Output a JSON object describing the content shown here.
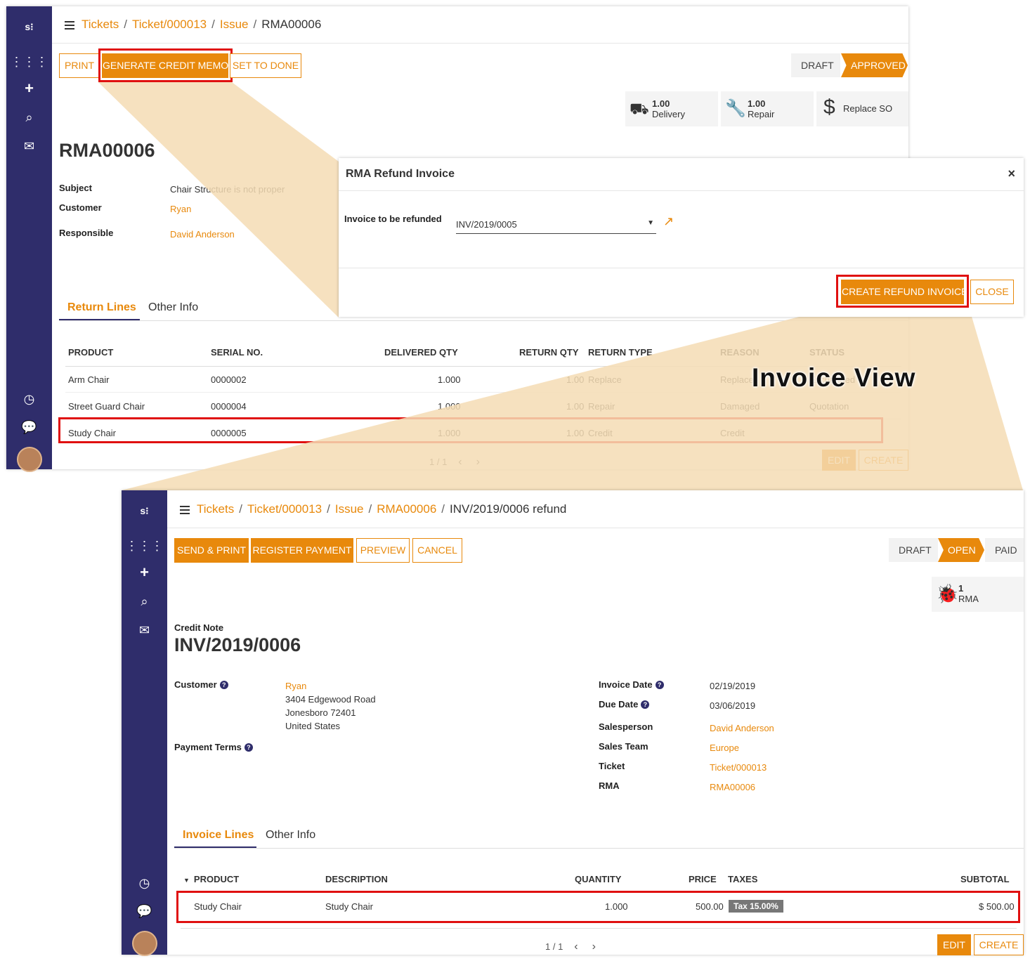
{
  "top": {
    "breadcrumb": [
      "Tickets",
      "Ticket/000013",
      "Issue",
      "RMA00006"
    ],
    "buttons": {
      "print": "PRINT",
      "generate": "GENERATE CREDIT MEMO",
      "set_done": "SET TO DONE"
    },
    "statuses": [
      "DRAFT",
      "APPROVED"
    ],
    "stats": [
      {
        "num": "1.00",
        "label": "Delivery",
        "icon": "truck-icon"
      },
      {
        "num": "1.00",
        "label": "Repair",
        "icon": "wrench-icon"
      },
      {
        "num": "",
        "label": "Replace SO",
        "icon": "dollar-icon"
      }
    ],
    "title": "RMA00006",
    "fields": {
      "subject_label": "Subject",
      "subject": "Chair Structure is not proper",
      "customer_label": "Customer",
      "customer": "Ryan",
      "responsible_label": "Responsible",
      "responsible": "David Anderson"
    },
    "tabs": [
      "Return Lines",
      "Other Info"
    ],
    "columns": [
      "PRODUCT",
      "SERIAL NO.",
      "DELIVERED QTY",
      "RETURN QTY",
      "RETURN TYPE",
      "REASON",
      "STATUS"
    ],
    "rows": [
      {
        "product": "Arm Chair",
        "serial": "0000002",
        "delivered": "1.000",
        "return_qty": "1.00",
        "type": "Replace",
        "reason": "Replace",
        "status": "Exchanged"
      },
      {
        "product": "Street Guard Chair",
        "serial": "0000004",
        "delivered": "1.000",
        "return_qty": "1.00",
        "type": "Repair",
        "reason": "Damaged",
        "status": "Quotation"
      },
      {
        "product": "Study Chair",
        "serial": "0000005",
        "delivered": "1.000",
        "return_qty": "1.00",
        "type": "Credit",
        "reason": "Credit",
        "status": ""
      }
    ],
    "pager": "1 / 1",
    "edit": "EDIT",
    "create": "CREATE"
  },
  "modal": {
    "title": "RMA Refund Invoice",
    "field_label": "Invoice to be refunded",
    "field_value": "INV/2019/0005",
    "create_button": "CREATE REFUND INVOICE",
    "close_button": "CLOSE"
  },
  "callout": "Invoice View",
  "bottom": {
    "breadcrumb": [
      "Tickets",
      "Ticket/000013",
      "Issue",
      "RMA00006",
      "INV/2019/0006 refund"
    ],
    "buttons": {
      "send_print": "SEND & PRINT",
      "register": "REGISTER PAYMENT",
      "preview": "PREVIEW",
      "cancel": "CANCEL"
    },
    "statuses": [
      "DRAFT",
      "OPEN",
      "PAID"
    ],
    "stat": {
      "num": "1",
      "label": "RMA",
      "icon": "bug-icon"
    },
    "subtitle": "Credit Note",
    "title": "INV/2019/0006",
    "left": {
      "customer_label": "Customer",
      "customer": "Ryan",
      "address": [
        "3404 Edgewood Road",
        "Jonesboro 72401",
        "United States"
      ],
      "payment_terms_label": "Payment Terms"
    },
    "right": [
      {
        "label": "Invoice Date",
        "value": "02/19/2019",
        "help": true,
        "link": false
      },
      {
        "label": "Due Date",
        "value": "03/06/2019",
        "help": true,
        "link": false
      },
      {
        "label": "Salesperson",
        "value": "David Anderson",
        "help": false,
        "link": true
      },
      {
        "label": "Sales Team",
        "value": "Europe",
        "help": false,
        "link": true
      },
      {
        "label": "Ticket",
        "value": "Ticket/000013",
        "help": false,
        "link": true
      },
      {
        "label": "RMA",
        "value": "RMA00006",
        "help": false,
        "link": true
      }
    ],
    "tabs": [
      "Invoice Lines",
      "Other Info"
    ],
    "columns": [
      "PRODUCT",
      "DESCRIPTION",
      "QUANTITY",
      "PRICE",
      "TAXES",
      "SUBTOTAL"
    ],
    "row": {
      "product": "Study Chair",
      "description": "Study Chair",
      "quantity": "1.000",
      "price": "500.00",
      "tax": "Tax 15.00%",
      "subtotal": "$ 500.00"
    },
    "pager": "1 / 1",
    "edit": "EDIT",
    "create": "CREATE"
  },
  "colors": {
    "accent": "#e8890c",
    "sidebar": "#2f2d6b",
    "highlight": "#e01010",
    "callout": "#f5dcb4"
  }
}
